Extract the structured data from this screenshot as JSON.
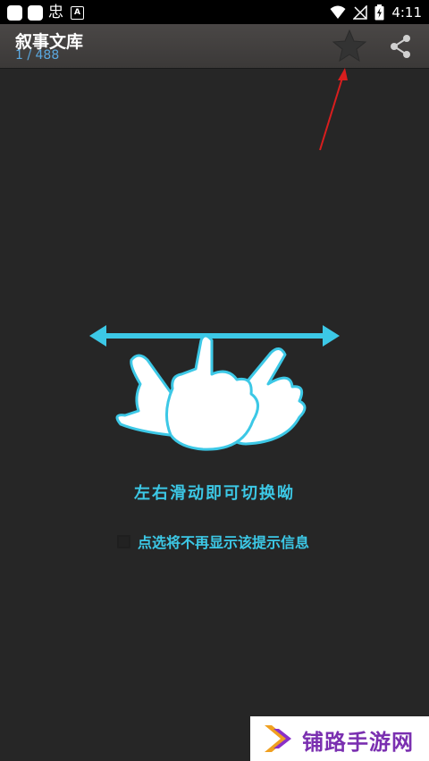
{
  "status_bar": {
    "glyph": "忠",
    "time": "4:11"
  },
  "app_bar": {
    "title": "叙事文库",
    "counter": "1 / 488",
    "star_icon": "star-icon",
    "share_icon": "share-icon"
  },
  "tutorial": {
    "hint": "左右滑动即可切换呦",
    "hide_option_label": "点选将不再显示该提示信息",
    "hide_option_checked": false,
    "accent_color": "#3cc8e6"
  },
  "watermark": {
    "text": "铺路手游网",
    "color": "#7a2fb0"
  }
}
